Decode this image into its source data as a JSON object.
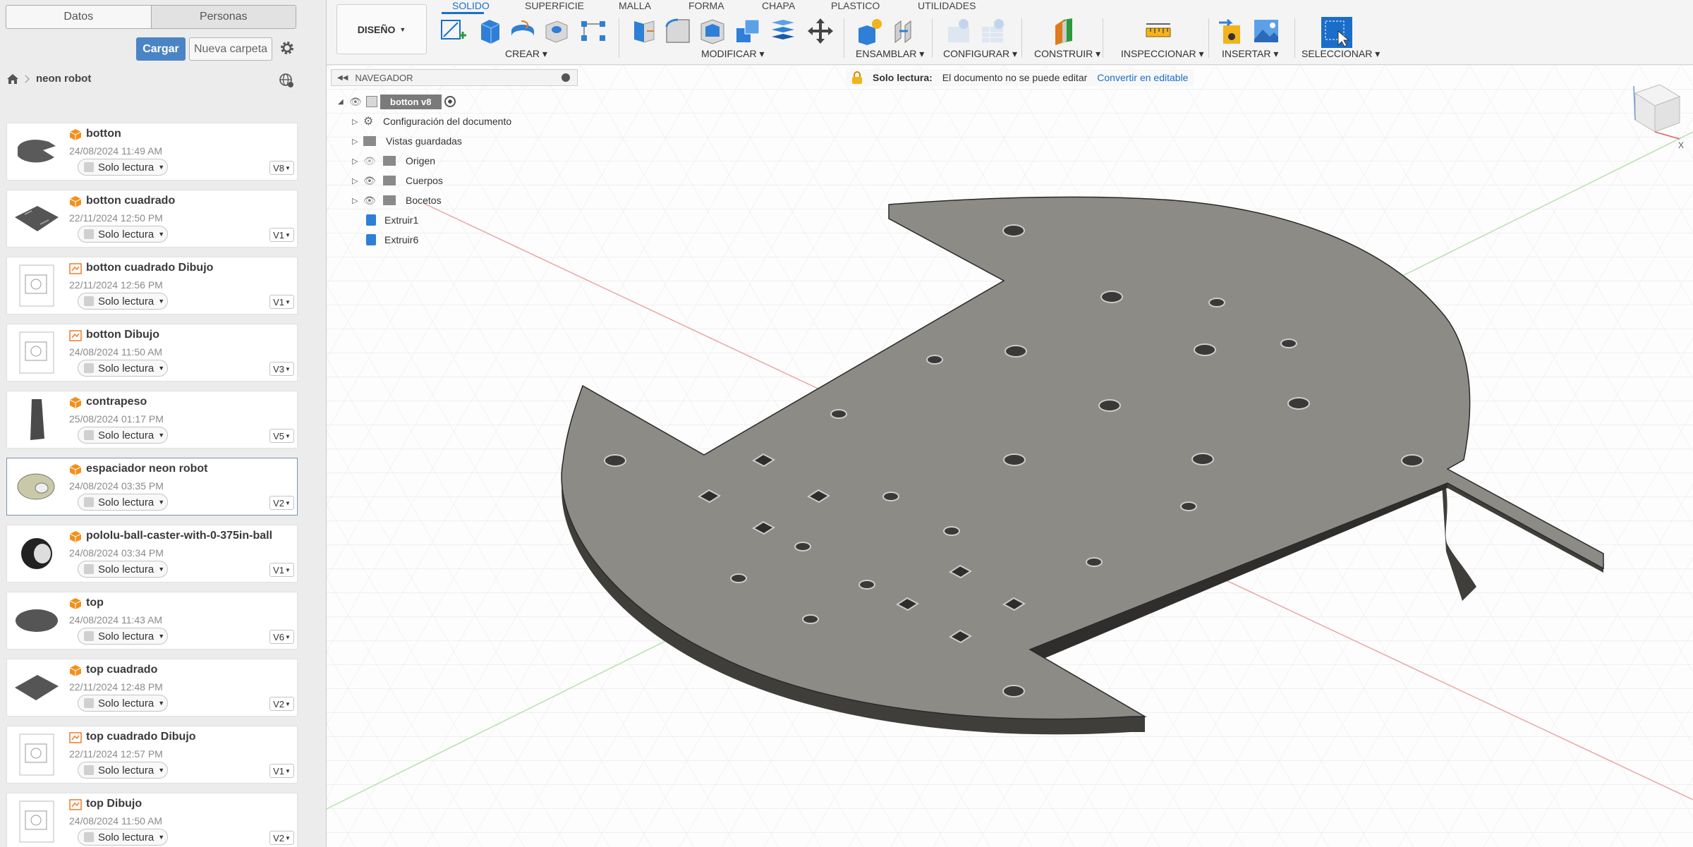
{
  "left_panel": {
    "tabs": [
      "Datos",
      "Personas"
    ],
    "upload_label": "Cargar",
    "new_folder_label": "Nueva carpeta",
    "project_name": "neon robot",
    "files": [
      {
        "name": "botton",
        "date": "24/08/2024 11:49 AM",
        "access": "Solo lectura",
        "version": "V8",
        "type": "model"
      },
      {
        "name": "botton cuadrado",
        "date": "22/11/2024 12:50 PM",
        "access": "Solo lectura",
        "version": "V1",
        "type": "model"
      },
      {
        "name": "botton cuadrado Dibujo",
        "date": "22/11/2024 12:56 PM",
        "access": "Solo lectura",
        "version": "V1",
        "type": "drawing"
      },
      {
        "name": "botton Dibujo",
        "date": "24/08/2024 11:50 AM",
        "access": "Solo lectura",
        "version": "V3",
        "type": "drawing"
      },
      {
        "name": "contrapeso",
        "date": "25/08/2024 01:17 PM",
        "access": "Solo lectura",
        "version": "V5",
        "type": "model"
      },
      {
        "name": "espaciador neon robot",
        "date": "24/08/2024 03:35 PM",
        "access": "Solo lectura",
        "version": "V2",
        "type": "model"
      },
      {
        "name": "pololu-ball-caster-with-0-375in-ball",
        "date": "24/08/2024 03:34 PM",
        "access": "Solo lectura",
        "version": "V1",
        "type": "model"
      },
      {
        "name": "top",
        "date": "24/08/2024 11:43 AM",
        "access": "Solo lectura",
        "version": "V6",
        "type": "model"
      },
      {
        "name": "top cuadrado",
        "date": "22/11/2024 12:48 PM",
        "access": "Solo lectura",
        "version": "V2",
        "type": "model"
      },
      {
        "name": "top cuadrado Dibujo",
        "date": "22/11/2024 12:57 PM",
        "access": "Solo lectura",
        "version": "V1",
        "type": "drawing"
      },
      {
        "name": "top Dibujo",
        "date": "24/08/2024 11:50 AM",
        "access": "Solo lectura",
        "version": "V2",
        "type": "drawing"
      }
    ]
  },
  "toolbar": {
    "workspace": "DISEÑO",
    "tabs": [
      "SOLIDO",
      "SUPERFICIE",
      "MALLA",
      "FORMA",
      "CHAPA",
      "PLASTICO",
      "UTILIDADES"
    ],
    "groups": [
      "CREAR",
      "MODIFICAR",
      "ENSAMBLAR",
      "CONFIGURAR",
      "CONSTRUIR",
      "INSPECCIONAR",
      "INSERTAR",
      "SELECCIONAR"
    ]
  },
  "browser": {
    "title": "NAVEGADOR",
    "root": "botton v8",
    "items": [
      "Configuración del documento",
      "Vistas guardadas",
      "Origen",
      "Cuerpos",
      "Bocetos",
      "Extruir1",
      "Extruir6"
    ]
  },
  "banner": {
    "label": "Solo lectura:",
    "message": "El documento no se puede editar",
    "action": "Convertir en editable"
  },
  "viewcube_axis": "X",
  "colors": {
    "accent": "#1a6ec9",
    "button": "#4a84c4",
    "plate": "#8d8b86"
  }
}
